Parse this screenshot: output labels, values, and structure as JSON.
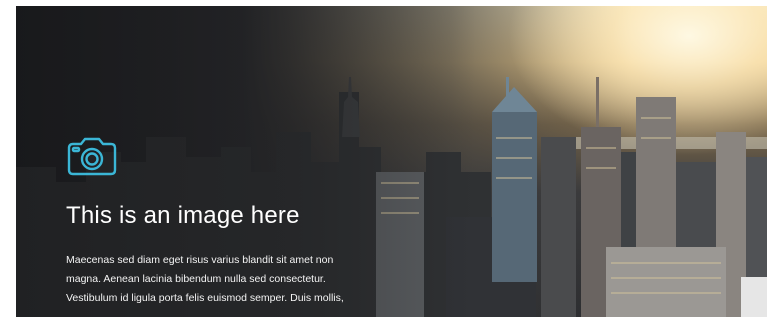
{
  "hero": {
    "title": "This is an image here",
    "body_lines": [
      "Maecenas sed diam eget risus varius blandit sit amet non",
      "magna. Aenean lacinia bibendum nulla sed consectetur.",
      "Vestibulum id ligula porta felis euismod semper. Duis mollis,"
    ],
    "icon": "camera-icon",
    "accent_color": "#3bb6d6"
  }
}
